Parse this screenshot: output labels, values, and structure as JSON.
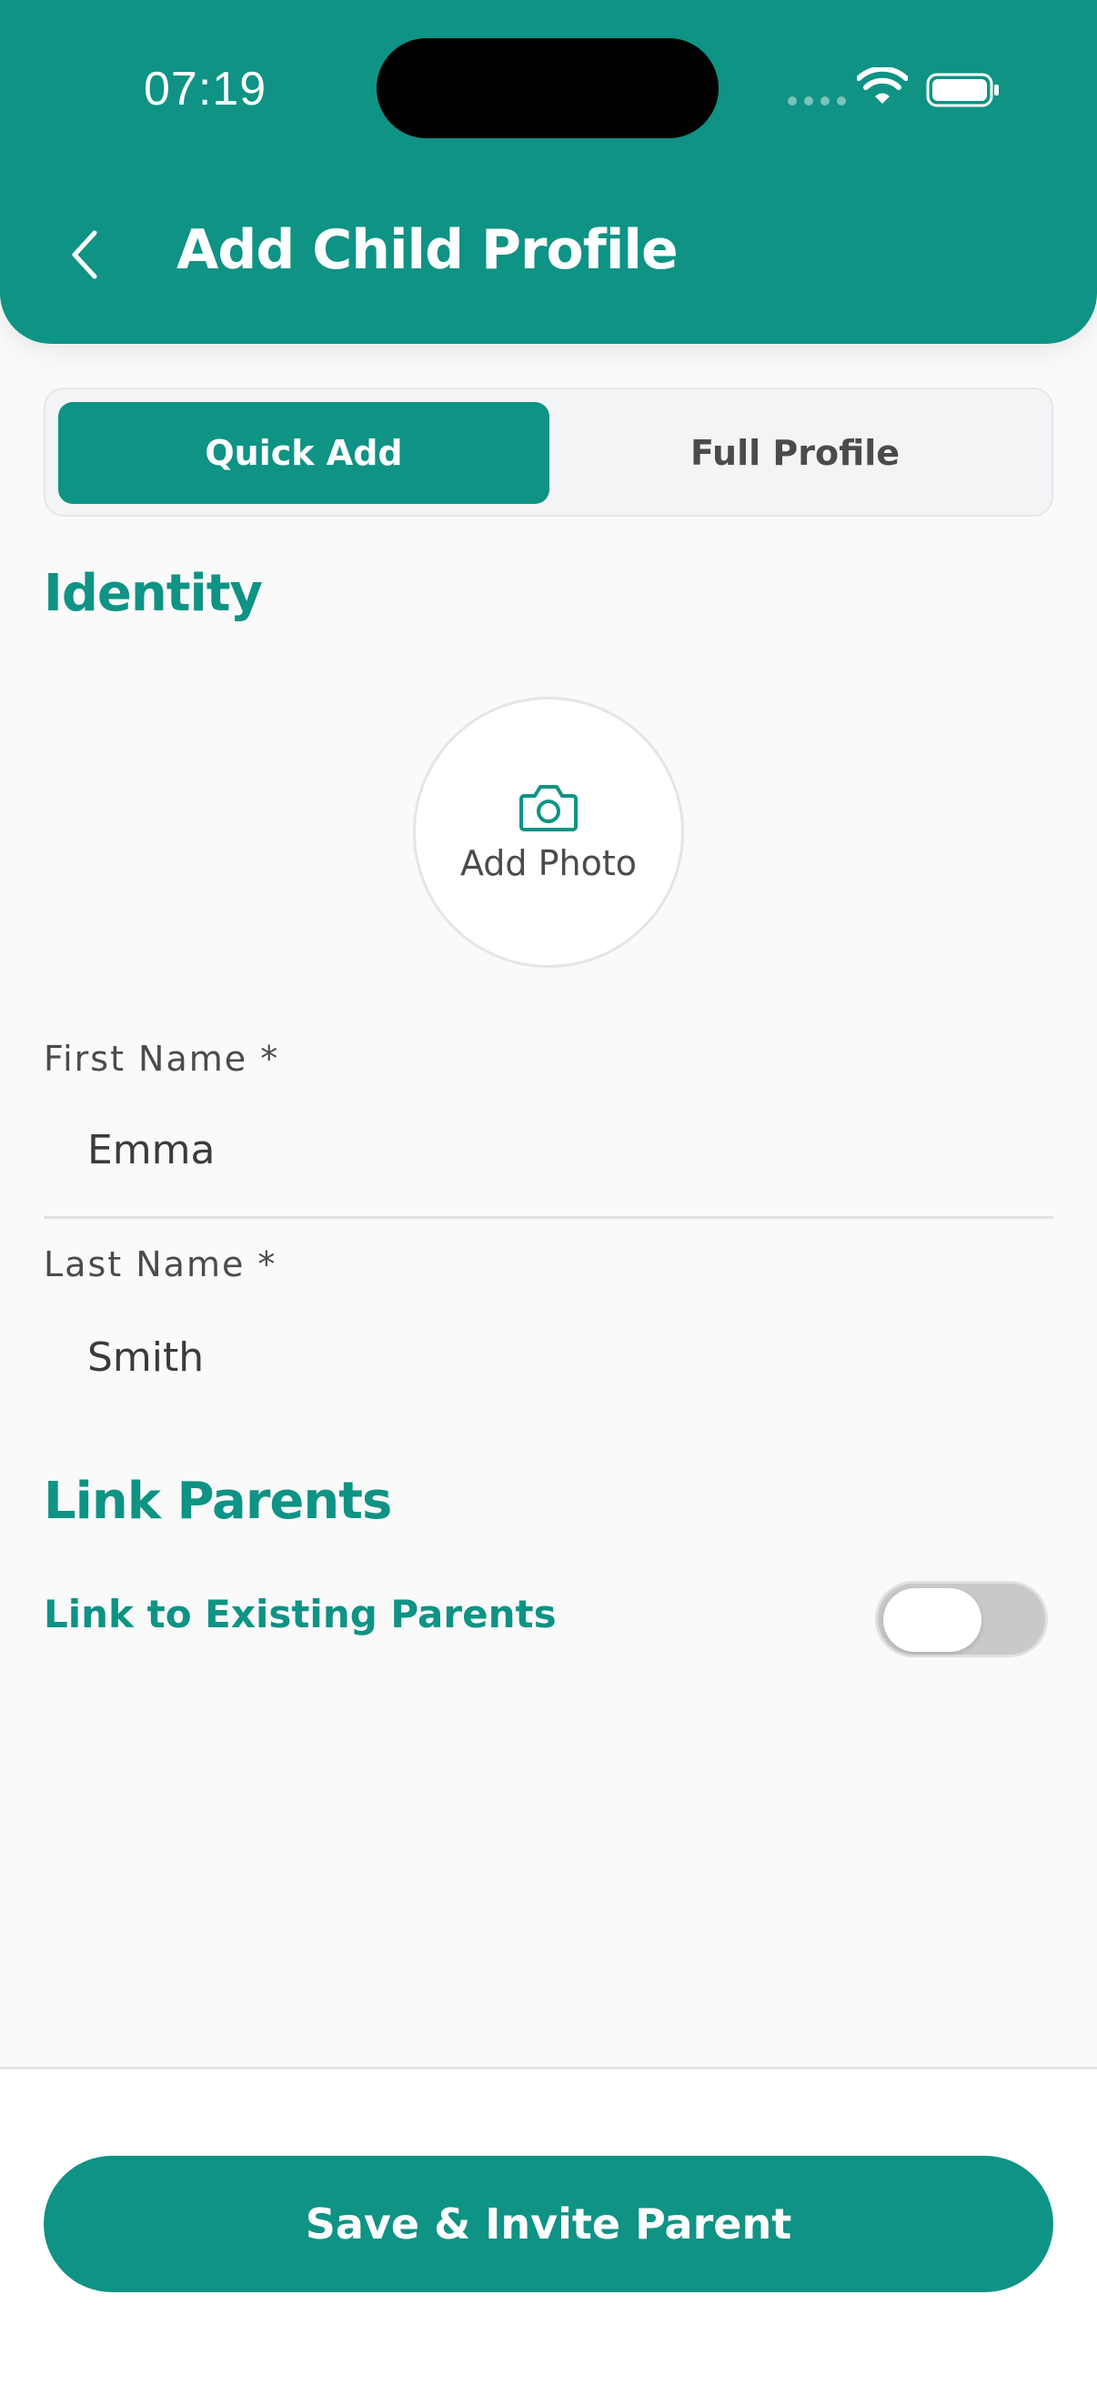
{
  "status_bar": {
    "time": "07:19"
  },
  "header": {
    "title": "Add Child Profile",
    "back_icon": "chevron-left-icon"
  },
  "segmented_control": {
    "quick_add": "Quick Add",
    "full_profile": "Full Profile",
    "selected": "Quick Add"
  },
  "identity": {
    "title": "Identity",
    "photo_label": "Add Photo",
    "photo_icon": "camera-icon",
    "first_name_label": "First Name *",
    "first_name_value": "Emma",
    "last_name_label": "Last Name *",
    "last_name_value": "Smith"
  },
  "link_parents": {
    "title": "Link Parents",
    "toggle_label": "Link to Existing Parents",
    "toggle_on": false
  },
  "footer": {
    "primary_button": "Save & Invite Parent"
  },
  "colors": {
    "accent": "#0E9384",
    "background": "#FAFAFA",
    "text_muted": "#4B4B4B"
  }
}
